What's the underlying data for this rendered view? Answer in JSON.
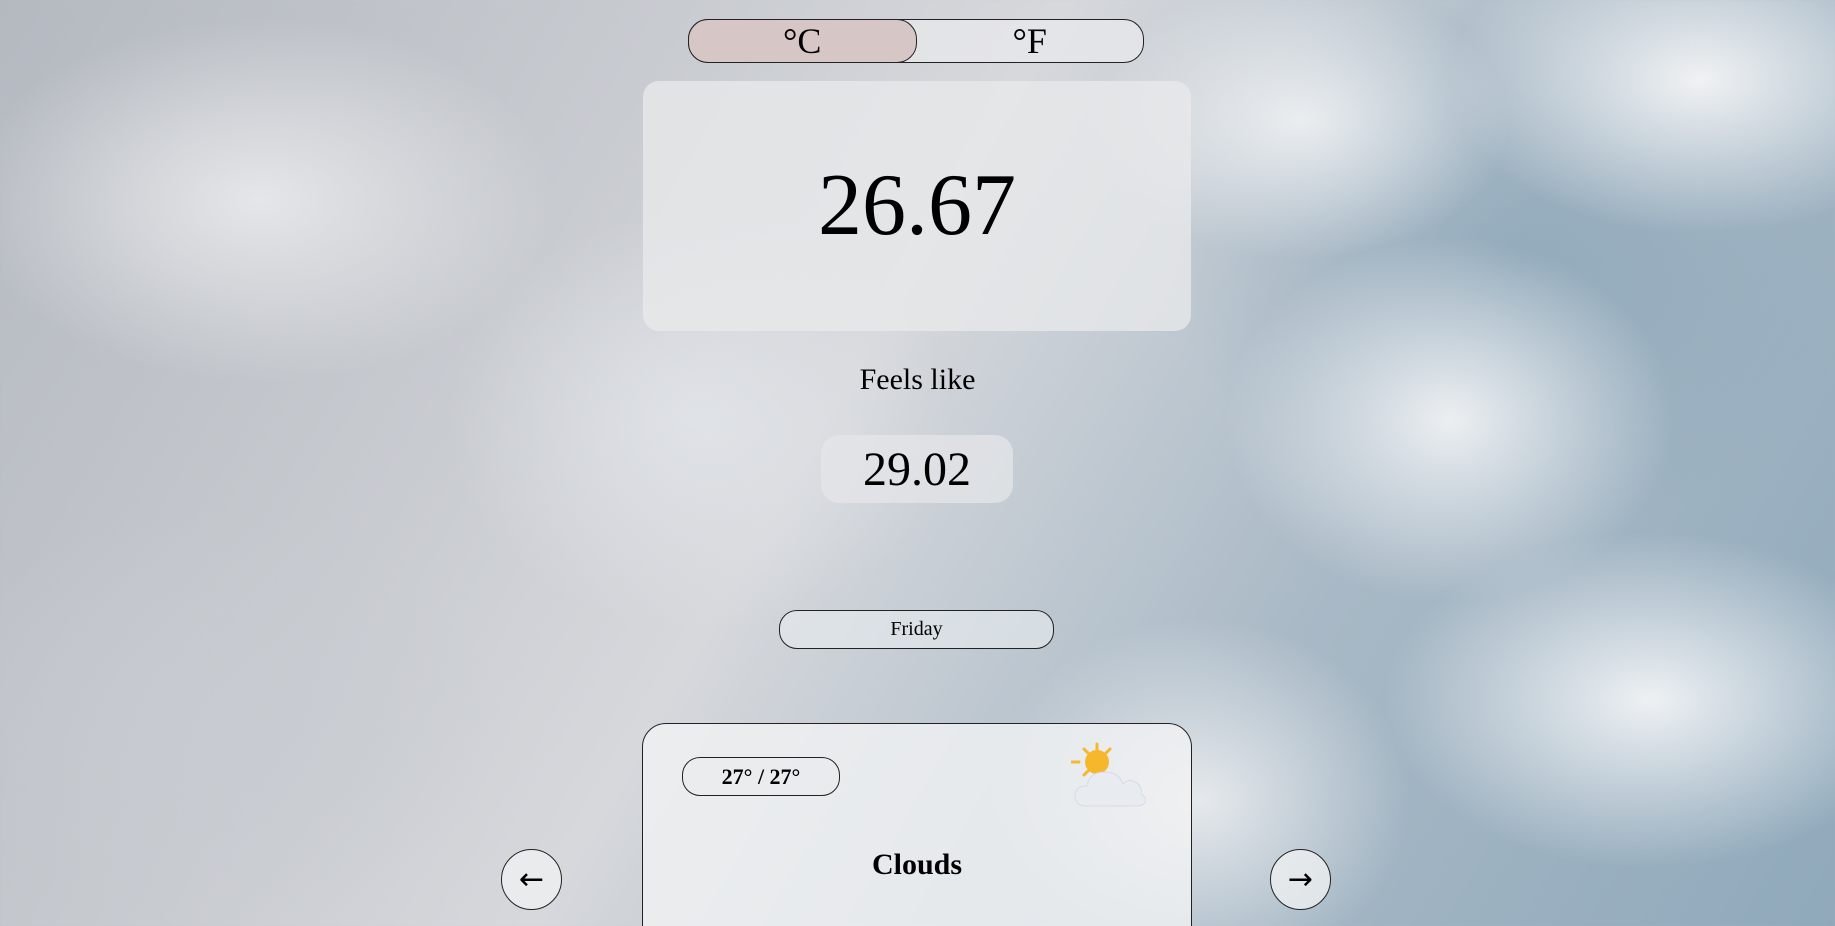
{
  "unit_toggle": {
    "celsius_label": "°C",
    "fahrenheit_label": "°F",
    "selected": "°C"
  },
  "current": {
    "temperature": "26.67",
    "feels_like_label": "Feels like",
    "feels_like_value": "29.02"
  },
  "forecast": {
    "day": "Friday",
    "hi_lo": "27° / 27°",
    "condition": "Clouds",
    "icon": "sun-behind-cloud-icon"
  },
  "nav": {
    "prev_label": "←",
    "next_label": "→"
  },
  "colors": {
    "active_toggle": "#d6c6c6",
    "sun": "#f6b72c",
    "cloud": "#e8ecf1"
  }
}
